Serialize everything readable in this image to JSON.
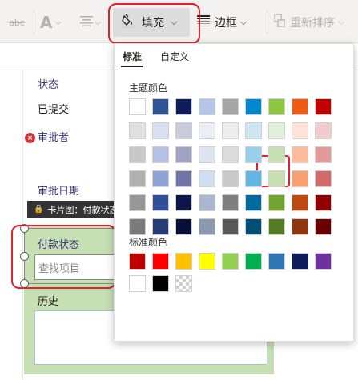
{
  "ribbon": {
    "strike_label": "abc",
    "font_color_letter": "A",
    "fill_label": "填充",
    "border_label": "边框",
    "reorder_label": "重新排序"
  },
  "form": {
    "status_label": "状态",
    "status_value": "已提交",
    "approver_label": "审批者",
    "approve_date_label": "审批日期",
    "tooltip": "卡片图：付款状态",
    "payment_status_label": "付款状态",
    "search_placeholder": "查找项目",
    "history_label": "历史"
  },
  "color_panel": {
    "tab_standard": "标准",
    "tab_custom": "自定义",
    "theme_title": "主题颜色",
    "standard_title": "标准颜色",
    "selected_color": "#c6e0b4",
    "theme_colors": [
      [
        "#ffffff",
        "#305496",
        "#0e1c5c",
        "#b4c6e7",
        "#a6a6a6",
        "#0087cd",
        "#8dc63f",
        "#f05a12",
        "#c00000"
      ],
      [
        "#e0e0e0",
        "#d9dff0",
        "#c9cbdd",
        "#eaeef7",
        "#ededed",
        "#cce6f4",
        "#e2efda",
        "#fde4d6",
        "#f2cccc"
      ],
      [
        "#c8c8c8",
        "#b4c0e4",
        "#9fa2c3",
        "#dce4f2",
        "#dbdbdb",
        "#99cdea",
        "#c6e0b4",
        "#fcbc9a",
        "#e19999"
      ],
      [
        "#b0b0b0",
        "#8ea1d8",
        "#6f73a6",
        "#d0dcef",
        "#c9c9c9",
        "#66b5e1",
        "#c6e0b4",
        "#f99f70",
        "#d16b6b"
      ],
      [
        "#969696",
        "#2f4f9a",
        "#0b1548",
        "#a9b8d0",
        "#7f7f7f",
        "#006aa0",
        "#6fa52e",
        "#c14810",
        "#900000"
      ],
      [
        "#7a7a7a",
        "#243d77",
        "#070f38",
        "#8a99b0",
        "#595959",
        "#004e76",
        "#527b22",
        "#91360c",
        "#6a0000"
      ]
    ],
    "standard_colors": [
      "#c00000",
      "#ff0000",
      "#ffc000",
      "#ffff00",
      "#92d050",
      "#00b050",
      "#2e75b6",
      "#0e1c5c",
      "#7030a0"
    ],
    "extra_colors": [
      "#ffffff",
      "#000000",
      "transparent"
    ]
  },
  "colors": {
    "accent_red": "#e0202a",
    "card_green": "#c6e0b4",
    "label_blue": "#3a3a7a"
  }
}
